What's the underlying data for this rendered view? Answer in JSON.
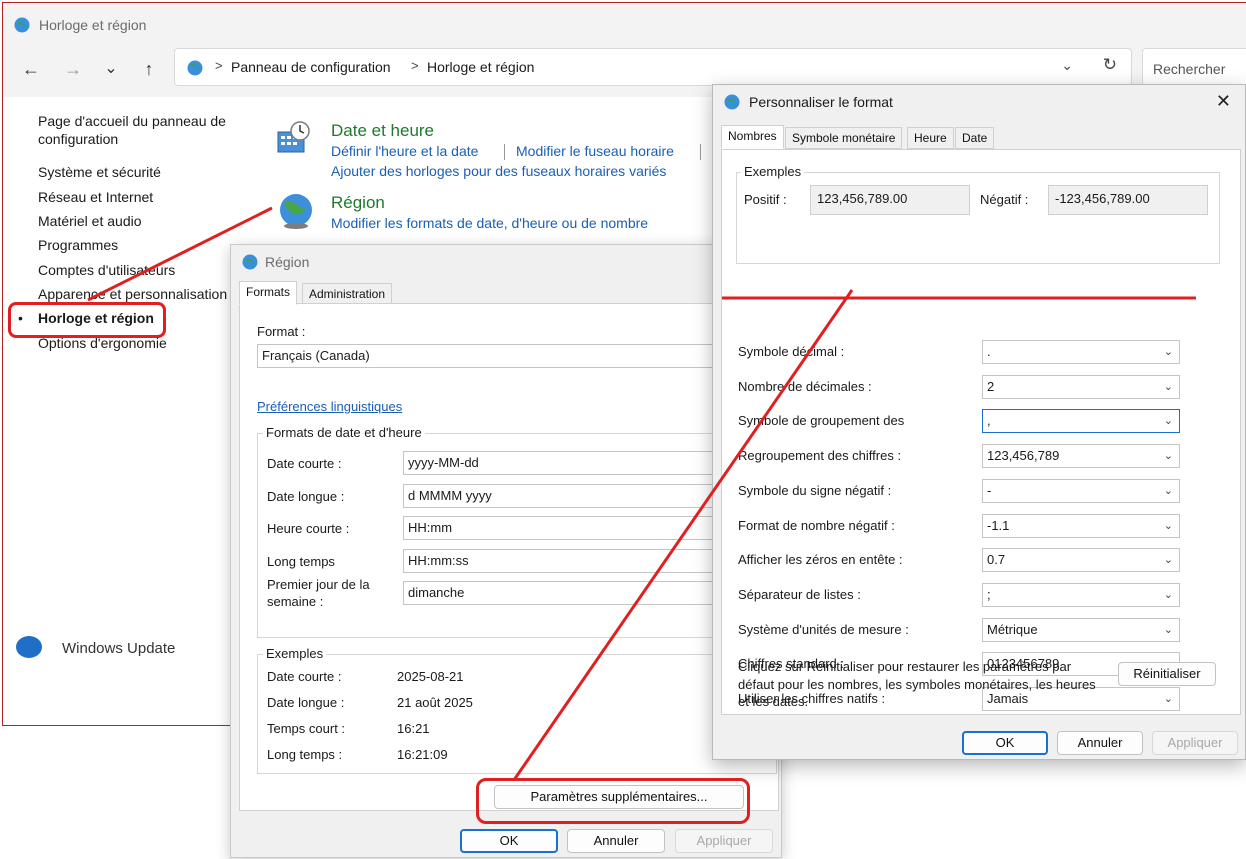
{
  "cp": {
    "title": "Horloge et région",
    "nav": {
      "back": "←",
      "forward": "→",
      "recent": "⌄",
      "up": "↑"
    },
    "address": {
      "sep": ">",
      "crumb1": "Panneau de configuration",
      "crumb2": "Horloge et région",
      "dropdown": "⌄",
      "refresh": "↻"
    },
    "search_placeholder": "Rechercher",
    "sidebar": {
      "home": "Page d'accueil du panneau de configuration",
      "items": [
        "Système et sécurité",
        "Réseau et Internet",
        "Matériel et audio",
        "Programmes",
        "Comptes d'utilisateurs",
        "Apparence et personnalisation",
        "Horloge et région",
        "Options d'ergonomie"
      ],
      "active_bullet": "•",
      "windows_update": "Windows Update"
    },
    "categories": {
      "datetime": {
        "title": "Date et heure",
        "link1": "Définir l'heure et la date",
        "link2": "Modifier le fuseau horaire",
        "link3": "Ajouter des horloges pour des fuseaux horaires variés"
      },
      "region": {
        "title": "Région",
        "link1": "Modifier les formats de date, d'heure ou de nombre"
      }
    }
  },
  "region": {
    "title": "Région",
    "tabs": [
      "Formats",
      "Administration"
    ],
    "format_label": "Format :",
    "format_value": "Français (Canada)",
    "lang_prefs": "Préférences linguistiques",
    "dt_group": "Formats de date et d'heure",
    "fields": [
      {
        "label": "Date courte :",
        "value": "yyyy-MM-dd"
      },
      {
        "label": "Date longue :",
        "value": "d MMMM yyyy"
      },
      {
        "label": "Heure courte :",
        "value": "HH:mm"
      },
      {
        "label": "Long temps",
        "value": "HH:mm:ss"
      },
      {
        "label": "Premier jour de la semaine :",
        "value": "dimanche"
      }
    ],
    "ex_group": "Exemples",
    "examples": [
      {
        "label": "Date courte :",
        "value": "2025-08-21"
      },
      {
        "label": "Date longue :",
        "value": "21 août 2025"
      },
      {
        "label": "Temps court :",
        "value": "16:21"
      },
      {
        "label": "Long temps :",
        "value": "16:21:09"
      }
    ],
    "more_button": "Paramètres supplémentaires...",
    "ok": "OK",
    "cancel": "Annuler",
    "apply": "Appliquer"
  },
  "fmt": {
    "title": "Personnaliser le format",
    "close": "✕",
    "tabs": [
      "Nombres",
      "Symbole monétaire",
      "Heure",
      "Date"
    ],
    "examples_group": "Exemples",
    "positive_label": "Positif :",
    "positive_value": "123,456,789.00",
    "negative_label": "Négatif :",
    "negative_value": "-123,456,789.00",
    "rows": [
      {
        "label": "Symbole décimal :",
        "value": "."
      },
      {
        "label": "Nombre de décimales :",
        "value": "2"
      },
      {
        "label": "Symbole de groupement des",
        "value": ","
      },
      {
        "label": "Regroupement des chiffres :",
        "value": "123,456,789"
      },
      {
        "label": "Symbole du signe négatif :",
        "value": "-"
      },
      {
        "label": "Format de nombre négatif :",
        "value": "-1.1"
      },
      {
        "label": "Afficher les zéros en entête :",
        "value": "0.7"
      },
      {
        "label": "Séparateur de listes :",
        "value": ";"
      },
      {
        "label": "Système d'unités de mesure :",
        "value": "Métrique"
      },
      {
        "label": "Chiffres standard :",
        "value": "0123456789"
      },
      {
        "label": "Utiliser les chiffres natifs :",
        "value": "Jamais"
      }
    ],
    "reset_text": "Cliquez sur Réinitialiser pour restaurer les paramètres par défaut pour les nombres, les symboles monétaires, les heures et les dates.",
    "reset_button": "Réinitialiser",
    "ok": "OK",
    "cancel": "Annuler",
    "apply": "Appliquer"
  },
  "colors": {
    "annotation": "#e02020",
    "link": "#1a5fb4",
    "category_title": "#1e7a2c"
  },
  "icons": {
    "globe": "globe-icon",
    "clock": "clock-calendar-icon",
    "region": "region-globe-icon",
    "chevron": "chevron-down-icon"
  },
  "chev": "⌄"
}
